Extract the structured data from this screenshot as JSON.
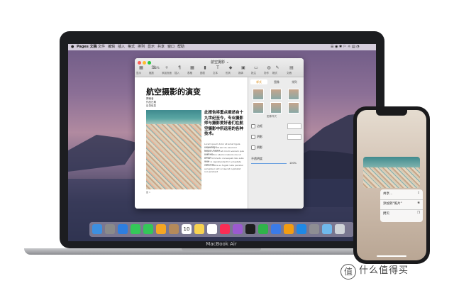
{
  "laptop": {
    "brand": "MacBook Air"
  },
  "menubar": {
    "apple": "",
    "items": [
      "Pages 文稿",
      "文件",
      "编辑",
      "插入",
      "格式",
      "排列",
      "显示",
      "共享",
      "窗口",
      "帮助"
    ],
    "status": "☰ ◉ ✱ ⚐ ☼ ▤ ◔"
  },
  "window": {
    "title": "航空摄影 ⌄",
    "toolbar": [
      {
        "icon": "view-icon",
        "glyph": "▦",
        "label": "显示"
      },
      {
        "icon": "zoom-icon",
        "glyph": "％",
        "label": "缩放"
      },
      {
        "icon": "add-page-icon",
        "glyph": "+",
        "label": "添加页面"
      },
      {
        "icon": "insert-icon",
        "glyph": "¶",
        "label": "插入"
      },
      {
        "icon": "table-icon",
        "glyph": "▦",
        "label": "表格"
      },
      {
        "icon": "chart-icon",
        "glyph": "▮",
        "label": "图表"
      },
      {
        "icon": "text-icon",
        "glyph": "T",
        "label": "文本"
      },
      {
        "icon": "shape-icon",
        "glyph": "◆",
        "label": "形状"
      },
      {
        "icon": "media-icon",
        "glyph": "▣",
        "label": "媒体"
      },
      {
        "icon": "comment-icon",
        "glyph": "▭",
        "label": "批注"
      },
      {
        "icon": "collaborate-icon",
        "glyph": "◍",
        "label": "协作"
      },
      {
        "icon": "format-icon",
        "glyph": "✎",
        "label": "格式"
      },
      {
        "icon": "document-icon",
        "glyph": "▤",
        "label": "文稿"
      }
    ],
    "zoom_value": "125%"
  },
  "document": {
    "title": "航空摄影的演变",
    "meta": [
      "撰稿者",
      "作品日期",
      "目录信息"
    ],
    "lead": "此报告将重点阐述自十九世纪至今，专业摄影师与摄影爱好者们在航空摄影中所运用的各种技术。",
    "body": [
      "Lorem ipsum dolor sit amet ligula consectetur",
      "adipiscing elit sed do eiusmod tempor magna",
      "aliqua ut enim ad minim veniam quis nostrud",
      "exercitation ullamco laboris nisi ut aliquip",
      "ex ea commodo consequat duis aute irure",
      "dolor in reprehenderit in voluptate velit esse",
      "cillum dolore eu fugiat nulla pariatur",
      "excepteur sint occaecat cupidatat non proident"
    ],
    "caption": "图 1"
  },
  "inspector": {
    "tabs": [
      "样式",
      "图像",
      "排列"
    ],
    "style_label": "图像样式",
    "rows": [
      {
        "label": "边框",
        "checked": true
      },
      {
        "label": "阴影",
        "checked": true
      },
      {
        "label": "倒影",
        "checked": false
      }
    ],
    "opacity_label": "不透明度",
    "opacity_value": "100%"
  },
  "dock": {
    "icons": [
      "finder-icon",
      "launchpad-icon",
      "safari-icon",
      "messages-icon",
      "facetime-icon",
      "photos-icon",
      "contacts-icon",
      "calendar-icon",
      "notes-icon",
      "reminders-icon",
      "music-icon",
      "podcasts-icon",
      "tv-icon",
      "numbers-icon",
      "keynote-icon",
      "pages-icon",
      "app-store-icon",
      "system-preferences-icon",
      "downloads-folder-icon",
      "trash-icon"
    ],
    "calendar_day": "10"
  },
  "phone": {
    "menu": [
      {
        "label": "共享...",
        "icon": "⇪"
      },
      {
        "label": "添加到\"照片\"",
        "icon": "❀"
      },
      {
        "label": "拷贝",
        "icon": "❐"
      }
    ]
  },
  "watermark": {
    "text": "什么值得买",
    "logo": "值"
  }
}
